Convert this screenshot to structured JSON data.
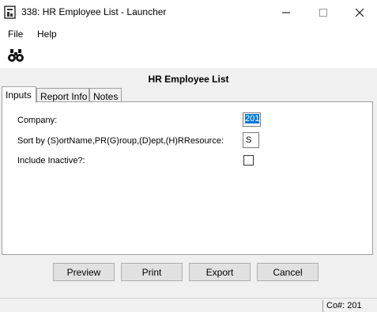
{
  "window": {
    "title": "338: HR Employee List - Launcher",
    "icon": "launcher-app-icon"
  },
  "menu": {
    "file": "File",
    "help": "Help"
  },
  "toolbar": {
    "find_icon": "binoculars-icon"
  },
  "report": {
    "title": "HR Employee List"
  },
  "tabs": [
    {
      "label": "Inputs",
      "active": true
    },
    {
      "label": "Report Info",
      "active": false
    },
    {
      "label": "Notes",
      "active": false
    }
  ],
  "inputs": {
    "company_label": "Company:",
    "company_value": "201",
    "sort_label": "Sort by (S)ortName,PR(G)roup,(D)ept,(H)RResource:",
    "sort_value": "S",
    "inactive_label": "Include Inactive?:",
    "inactive_checked": false
  },
  "buttons": {
    "preview": "Preview",
    "print": "Print",
    "export": "Export",
    "cancel": "Cancel"
  },
  "status": {
    "company": "Co#: 201"
  },
  "colors": {
    "selection": "#0078d7",
    "window_bg": "#f0f0f0",
    "panel_bg": "#ffffff"
  }
}
